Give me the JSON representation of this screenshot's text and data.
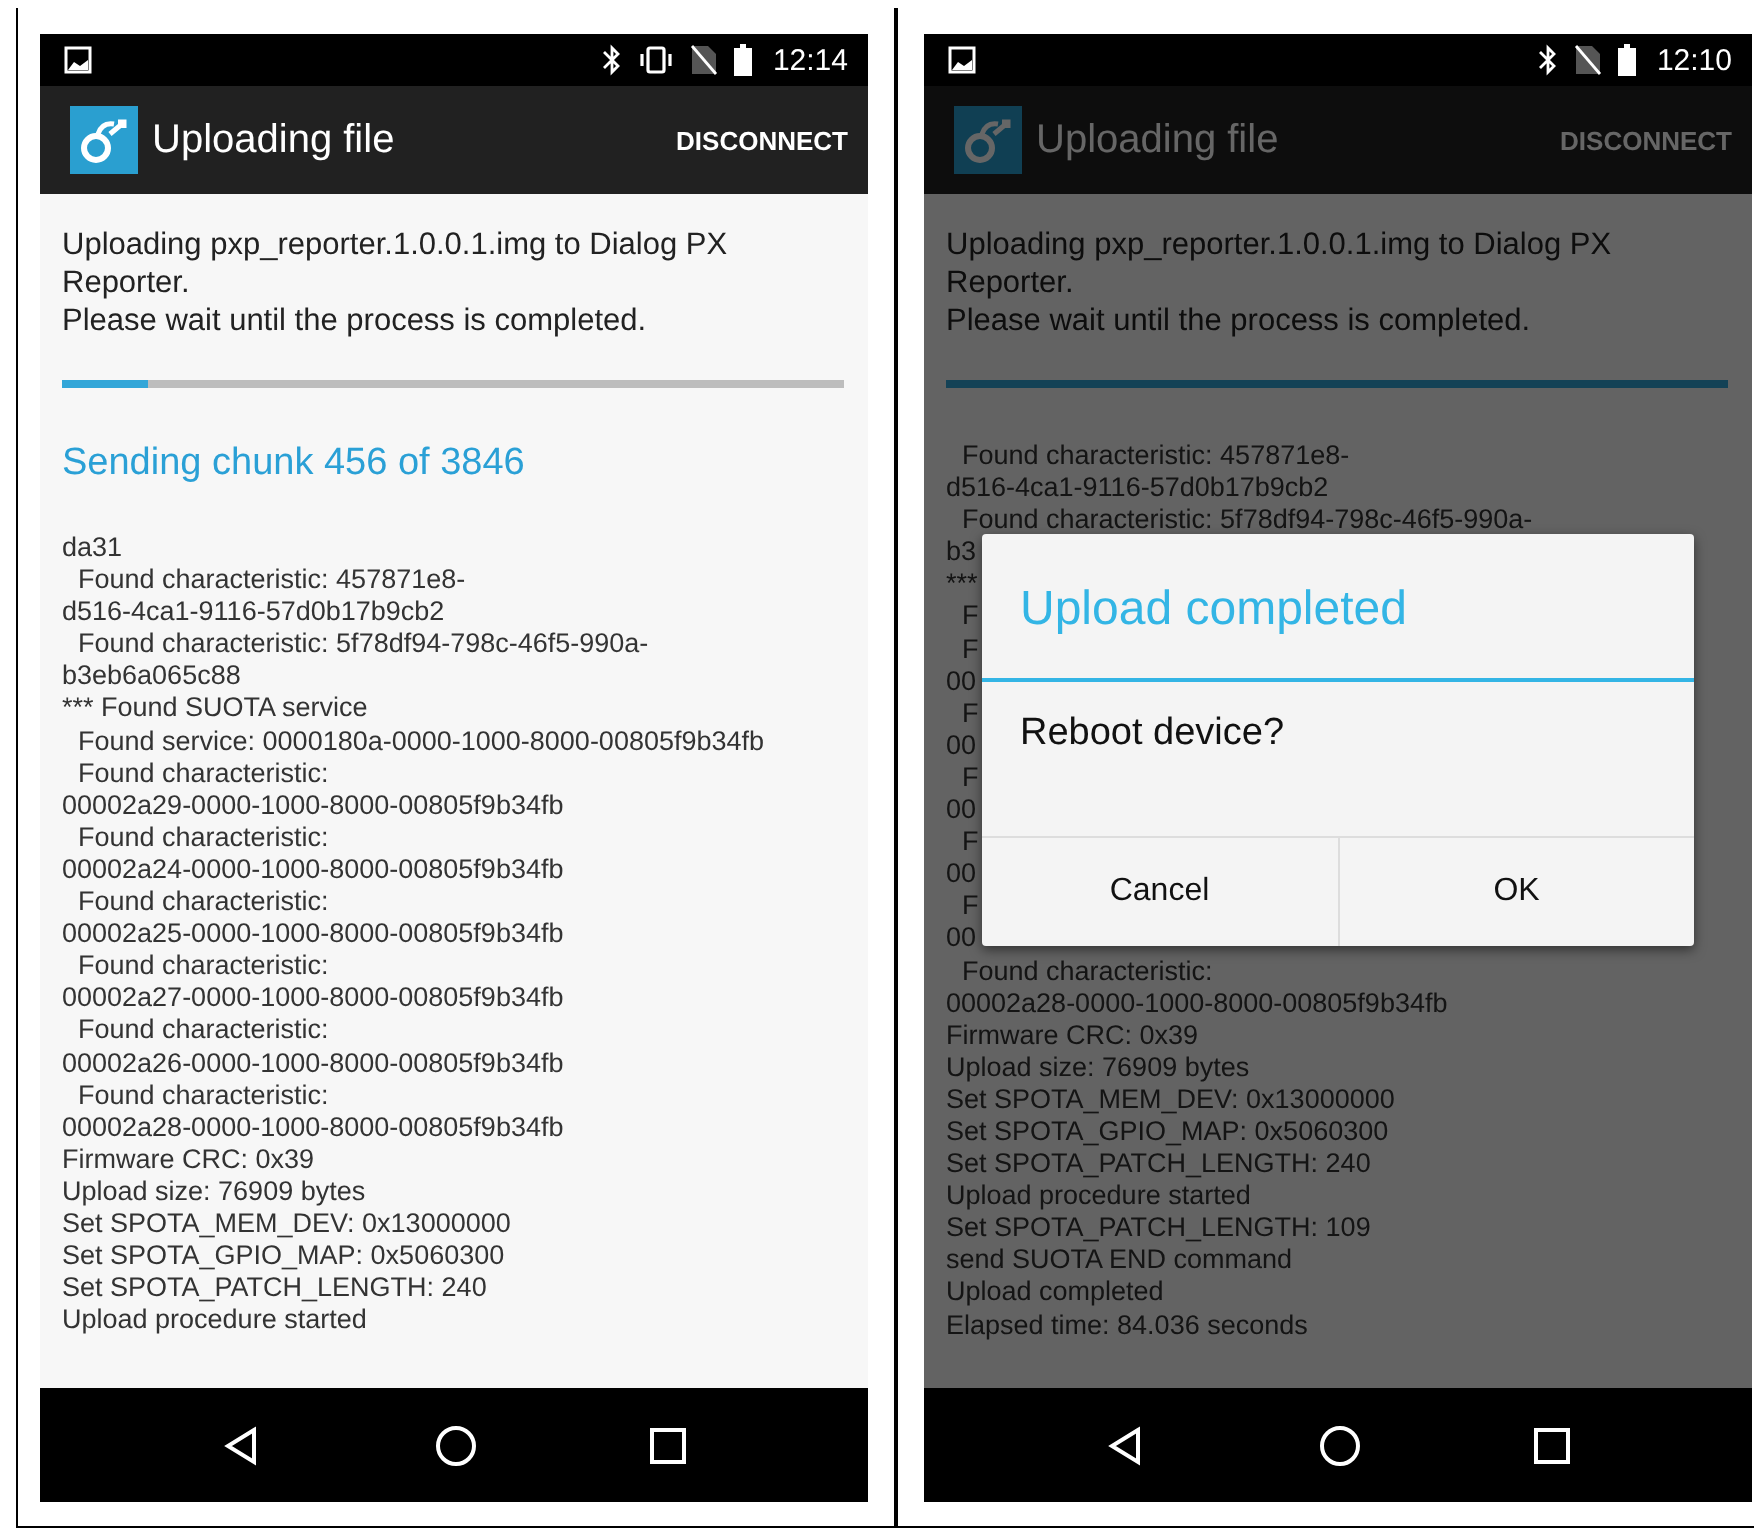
{
  "screens": [
    {
      "status_bar": {
        "time": "12:14",
        "vibrate": true
      },
      "app_bar": {
        "title": "Uploading file",
        "action": "DISCONNECT"
      },
      "message": "Uploading pxp_reporter.1.0.0.1.img to Dialog PX Reporter.",
      "note": "Please wait until the process is completed.",
      "progress": {
        "level": 0.11
      },
      "status_text": "Sending chunk 456 of 3846",
      "dimmed": false,
      "log": [
        {
          "text": "da31",
          "indented": false
        },
        {
          "text": "Found characteristic: 457871e8-",
          "indented": true
        },
        {
          "text": "d516-4ca1-9116-57d0b17b9cb2",
          "indented": false
        },
        {
          "text": "Found characteristic: 5f78df94-798c-46f5-990a-",
          "indented": true
        },
        {
          "text": "b3eb6a065c88",
          "indented": false
        },
        {
          "text": "*** Found SUOTA service",
          "indented": false
        },
        {
          "text": "Found service: 0000180a-0000-1000-8000-00805f9b34fb",
          "indented": true
        },
        {
          "text": "Found characteristic:",
          "indented": true
        },
        {
          "text": "00002a29-0000-1000-8000-00805f9b34fb",
          "indented": false
        },
        {
          "text": "Found characteristic:",
          "indented": true
        },
        {
          "text": "00002a24-0000-1000-8000-00805f9b34fb",
          "indented": false
        },
        {
          "text": "Found characteristic:",
          "indented": true
        },
        {
          "text": "00002a25-0000-1000-8000-00805f9b34fb",
          "indented": false
        },
        {
          "text": "Found characteristic:",
          "indented": true
        },
        {
          "text": "00002a27-0000-1000-8000-00805f9b34fb",
          "indented": false
        },
        {
          "text": "Found characteristic:",
          "indented": true
        },
        {
          "text": "00002a26-0000-1000-8000-00805f9b34fb",
          "indented": false
        },
        {
          "text": "Found characteristic:",
          "indented": true
        },
        {
          "text": "00002a28-0000-1000-8000-00805f9b34fb",
          "indented": false
        },
        {
          "text": "Firmware CRC: 0x39",
          "indented": false
        },
        {
          "text": "Upload size: 76909 bytes",
          "indented": false
        },
        {
          "text": "Set SPOTA_MEM_DEV: 0x13000000",
          "indented": false
        },
        {
          "text": "Set SPOTA_GPIO_MAP:  0x5060300",
          "indented": false
        },
        {
          "text": "Set SPOTA_PATCH_LENGTH: 240",
          "indented": false
        },
        {
          "text": "Upload procedure started",
          "indented": false
        }
      ]
    },
    {
      "status_bar": {
        "time": "12:10",
        "vibrate": false
      },
      "app_bar": {
        "title": "Uploading file",
        "action": "DISCONNECT"
      },
      "message": "Uploading pxp_reporter.1.0.0.1.img to Dialog PX Reporter.",
      "note": "Please wait until the process is completed.",
      "progress": {
        "level": 1
      },
      "dimmed": true,
      "log": [
        {
          "text": "Found characteristic: 457871e8-",
          "indented": true
        },
        {
          "text": "d516-4ca1-9116-57d0b17b9cb2",
          "indented": false
        },
        {
          "text": "Found characteristic: 5f78df94-798c-46f5-990a-",
          "indented": true
        },
        {
          "text": "b3",
          "indented": false
        },
        {
          "text": "***",
          "indented": false
        },
        {
          "text": "F",
          "indented": true
        },
        {
          "text": "F",
          "indented": true
        },
        {
          "text": "00",
          "indented": false
        },
        {
          "text": "F",
          "indented": true
        },
        {
          "text": "00",
          "indented": false
        },
        {
          "text": "F",
          "indented": true
        },
        {
          "text": "00",
          "indented": false
        },
        {
          "text": "F",
          "indented": true
        },
        {
          "text": "00",
          "indented": false
        },
        {
          "text": "F",
          "indented": true
        },
        {
          "text": "00",
          "indented": false
        },
        {
          "text": "Found characteristic:",
          "indented": true
        },
        {
          "text": "00002a28-0000-1000-8000-00805f9b34fb",
          "indented": false
        },
        {
          "text": "Firmware CRC: 0x39",
          "indented": false
        },
        {
          "text": "Upload size: 76909 bytes",
          "indented": false
        },
        {
          "text": "Set SPOTA_MEM_DEV: 0x13000000",
          "indented": false
        },
        {
          "text": "Set SPOTA_GPIO_MAP:  0x5060300",
          "indented": false
        },
        {
          "text": "Set SPOTA_PATCH_LENGTH: 240",
          "indented": false
        },
        {
          "text": "Upload procedure started",
          "indented": false
        },
        {
          "text": "Set SPOTA_PATCH_LENGTH: 109",
          "indented": false
        },
        {
          "text": "send SUOTA END command",
          "indented": false
        },
        {
          "text": "Upload completed",
          "indented": false
        },
        {
          "text": "Elapsed time: 84.036 seconds",
          "indented": false
        }
      ],
      "dialog": {
        "title": "Upload completed",
        "message": "Reboot device?",
        "buttons": [
          "Cancel",
          "OK"
        ]
      }
    }
  ]
}
